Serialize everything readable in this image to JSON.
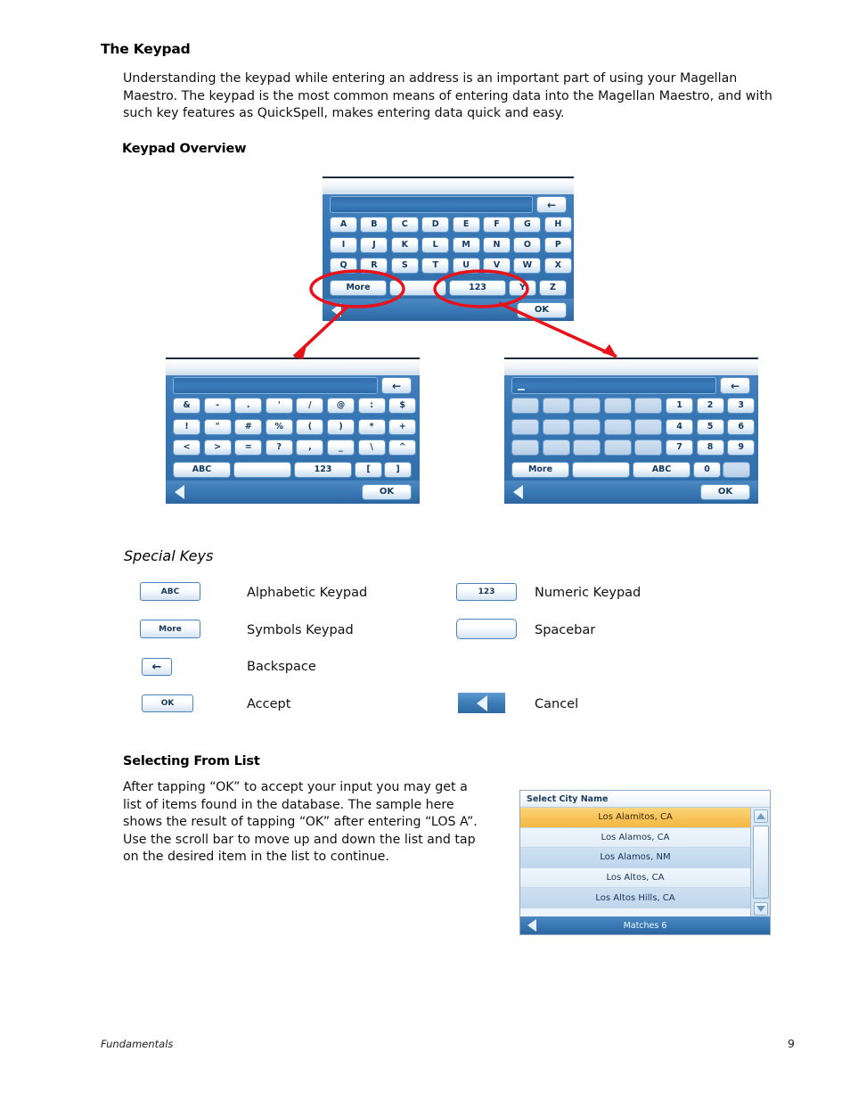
{
  "page": {
    "footer_section": "Fundamentals",
    "footer_page_number": "9"
  },
  "section_keypad": {
    "title": "The Keypad",
    "paragraph": "Understanding the keypad while entering an address is an important part of using your Magellan Maestro.  The keypad is the most common means of entering data into the Magellan Maestro, and with such key features as QuickSpell, makes entering data quick and easy.",
    "subtitle": "Keypad Overview"
  },
  "alpha_keypad": {
    "backspace_label": "←",
    "rows": [
      [
        "A",
        "B",
        "C",
        "D",
        "E",
        "F",
        "G",
        "H"
      ],
      [
        "I",
        "J",
        "K",
        "L",
        "M",
        "N",
        "O",
        "P"
      ],
      [
        "Q",
        "R",
        "S",
        "T",
        "U",
        "V",
        "W",
        "X"
      ]
    ],
    "bottom_row": {
      "more": "More",
      "space": "",
      "numeric": "123",
      "y": "Y",
      "z": "Z"
    },
    "ok_label": "OK"
  },
  "symbol_keypad": {
    "backspace_label": "←",
    "rows": [
      [
        "&",
        "-",
        ".",
        "'",
        "/",
        "@",
        ":",
        "$"
      ],
      [
        "!",
        "\"",
        "#",
        "%",
        "(",
        ")",
        "*",
        "+"
      ],
      [
        "<",
        ">",
        "=",
        "?",
        ",",
        "_",
        "\\",
        "^"
      ]
    ],
    "bottom_row": {
      "abc": "ABC",
      "space": "",
      "numeric": "123",
      "lbracket": "[",
      "rbracket": "]"
    },
    "ok_label": "OK"
  },
  "numeric_keypad": {
    "backspace_label": "←",
    "rows": [
      [
        "",
        "",
        "",
        "",
        "",
        "1",
        "2",
        "3"
      ],
      [
        "",
        "",
        "",
        "",
        "",
        "4",
        "5",
        "6"
      ],
      [
        "",
        "",
        "",
        "",
        "",
        "7",
        "8",
        "9"
      ]
    ],
    "bottom_row": {
      "more": "More",
      "space": "",
      "abc": "ABC",
      "zero": "0",
      "blank": ""
    },
    "ok_label": "OK"
  },
  "special_keys": {
    "title": "Special Keys",
    "items": [
      {
        "key_label": "ABC",
        "description": "Alphabetic Keypad"
      },
      {
        "key_label": "123",
        "description": "Numeric Keypad"
      },
      {
        "key_label": "More",
        "description": "Symbols Keypad"
      },
      {
        "key_label": "",
        "description": "Spacebar"
      },
      {
        "key_label": "←",
        "description": "Backspace"
      },
      {
        "key_label": "OK",
        "description": "Accept"
      },
      {
        "key_label": "",
        "description": "Cancel"
      }
    ]
  },
  "selecting_from_list": {
    "title": "Selecting From List",
    "paragraph": "After tapping “OK” to accept your input you may get a list of items found in the database.  The sample here shows the result of tapping “OK” after entering “LOS A”.  Use the scroll bar to move up and down the list and tap on the desired item in the list to continue."
  },
  "city_list": {
    "header": "Select City Name",
    "items": [
      "Los Alamitos, CA",
      "Los Alamos, CA",
      "Los Alamos, NM",
      "Los Altos, CA",
      "Los Altos Hills, CA"
    ],
    "selected_index": 0,
    "footer": "Matches  6"
  },
  "colors": {
    "device_blue": "#3d7ab8",
    "field_blue": "#2e6ca9",
    "key_face": "#ffffff",
    "key_border": "#5d95c8",
    "annotation_red": "#e8121a",
    "list_highlight": "#f8c45c"
  }
}
